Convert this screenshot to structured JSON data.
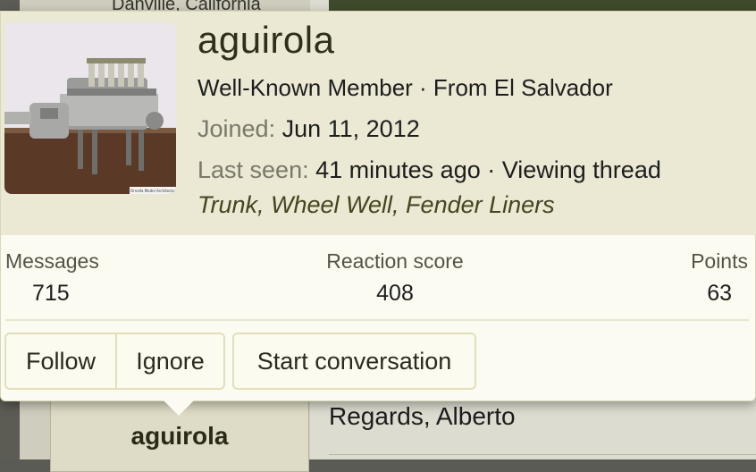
{
  "background": {
    "location_text": "Danville, California",
    "post_author": "aguirola",
    "signature": "Regards, Alberto"
  },
  "profile": {
    "name": "aguirola",
    "title_line": "Well-Known Member · From El Salvador",
    "joined_label": "Joined:",
    "joined_value": "Jun 11, 2012",
    "last_seen_label": "Last seen:",
    "last_seen_value": "41 minutes ago · Viewing thread",
    "thread_link": "Trunk, Wheel Well, Fender Liners",
    "avatar_caption": "Ornella Model Architects"
  },
  "stats": {
    "messages_label": "Messages",
    "messages_value": "715",
    "reaction_label": "Reaction score",
    "reaction_value": "408",
    "points_label": "Points",
    "points_value": "63"
  },
  "actions": {
    "follow": "Follow",
    "ignore": "Ignore",
    "conversation": "Start conversation"
  },
  "colors": {
    "header_bg": "#ebe8d4",
    "card_bg": "#fbfbf2",
    "button_border": "#e2dfba",
    "name_color": "#30301a"
  }
}
